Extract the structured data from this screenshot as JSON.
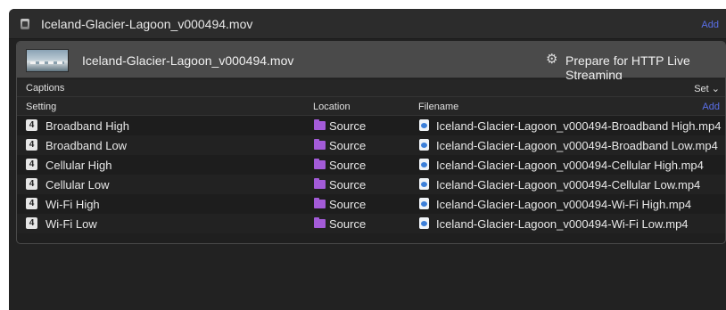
{
  "window": {
    "title": "Iceland-Glacier-Lagoon_v000494.mov",
    "add_label": "Add"
  },
  "job": {
    "title": "Iceland-Glacier-Lagoon_v000494.mov",
    "action_label": "Prepare for HTTP Live Streaming"
  },
  "captions": {
    "label": "Captions",
    "set_label": "Set ⌄"
  },
  "table": {
    "headers": {
      "setting": "Setting",
      "location": "Location",
      "filename": "Filename",
      "add": "Add"
    },
    "rows": [
      {
        "badge": "4",
        "setting": "Broadband High",
        "location": "Source",
        "filename": "Iceland-Glacier-Lagoon_v000494-Broadband High.mp4"
      },
      {
        "badge": "4",
        "setting": "Broadband Low",
        "location": "Source",
        "filename": "Iceland-Glacier-Lagoon_v000494-Broadband Low.mp4"
      },
      {
        "badge": "4",
        "setting": "Cellular High",
        "location": "Source",
        "filename": "Iceland-Glacier-Lagoon_v000494-Cellular High.mp4"
      },
      {
        "badge": "4",
        "setting": "Cellular Low",
        "location": "Source",
        "filename": "Iceland-Glacier-Lagoon_v000494-Cellular Low.mp4"
      },
      {
        "badge": "4",
        "setting": "Wi-Fi High",
        "location": "Source",
        "filename": "Iceland-Glacier-Lagoon_v000494-Wi-Fi High.mp4"
      },
      {
        "badge": "4",
        "setting": "Wi-Fi Low",
        "location": "Source",
        "filename": "Iceland-Glacier-Lagoon_v000494-Wi-Fi Low.mp4"
      }
    ]
  },
  "colors": {
    "accent": "#5a6fe8",
    "folder": "#a35bd8",
    "file": "#3b7fd9"
  }
}
